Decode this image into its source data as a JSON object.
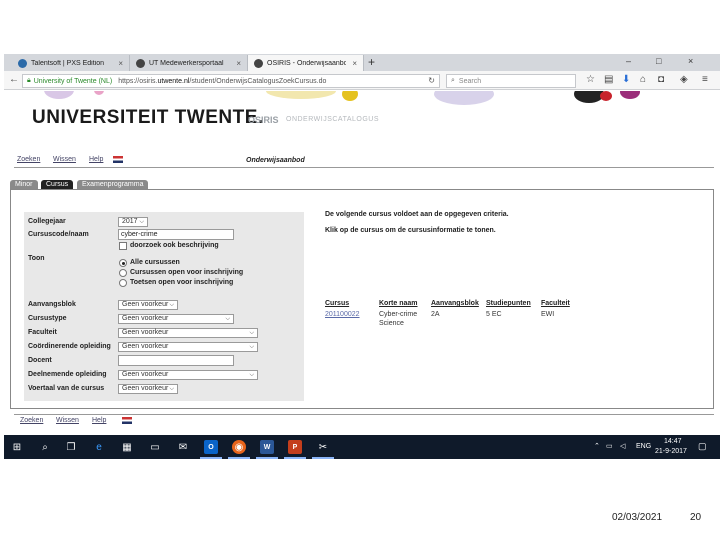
{
  "browser": {
    "tabs": [
      {
        "label": "Talentsoft | PXS Edition",
        "close": "×"
      },
      {
        "label": "UT Medewerkersportaal",
        "close": "×"
      },
      {
        "label": "OSIRIS - Onderwijsaanbod",
        "close": "×"
      }
    ],
    "new_tab": "+",
    "window_controls": [
      "–",
      "□",
      "×"
    ],
    "site_identity": "University of Twente (NL)",
    "url_prefix": "https://osiris.",
    "url_domain": "utwente.nl",
    "url_path": "/student/OnderwijsCatalogusZoekCursus.do",
    "search_placeholder": "Search"
  },
  "header": {
    "university": "UNIVERSITEIT TWENTE.",
    "app_name": "OSIRIS",
    "app_subtitle": "ONDERWIJSCATALOGUS"
  },
  "toplinks": {
    "zoeken": "Zoeken",
    "wissen": "Wissen",
    "help": "Help"
  },
  "section_title": "Onderwijsaanbod",
  "page_tabs": [
    "Minor",
    "Cursus",
    "Examenprogramma"
  ],
  "form": {
    "collegejaar_label": "Collegejaar",
    "collegejaar_value": "2017",
    "cursuscode_label": "Cursuscode/naam",
    "cursuscode_value": "cyber-crime",
    "doorzoek_label": "doorzoek ook beschrijving",
    "toon_label": "Toon",
    "toon_options": [
      "Alle cursussen",
      "Cursussen open voor inschrijving",
      "Toetsen open voor inschrijving"
    ],
    "aanvangsblok_label": "Aanvangsblok",
    "aanvangsblok_value": "Geen voorkeur",
    "cursustype_label": "Cursustype",
    "cursustype_value": "Geen voorkeur",
    "faculteit_label": "Faculteit",
    "faculteit_value": "Geen voorkeur",
    "coordinerende_label": "Coördinerende opleiding",
    "coordinerende_value": "Geen voorkeur",
    "docent_label": "Docent",
    "docent_value": "",
    "deelnemende_label": "Deelnemende opleiding",
    "deelnemende_value": "Geen voorkeur",
    "voertaal_label": "Voertaal van de cursus",
    "voertaal_value": "Geen voorkeur"
  },
  "results": {
    "line1": "De volgende cursus voldoet aan de opgegeven criteria.",
    "line2": "Klik op de cursus om de cursusinformatie te tonen.",
    "headers": [
      "Cursus",
      "Korte naam",
      "Aanvangsblok",
      "Studiepunten",
      "Faculteit"
    ],
    "row": {
      "cursus": "201100022",
      "korte_naam_1": "Cyber-crime",
      "korte_naam_2": "Science",
      "aanvangsblok": "2A",
      "studiepunten": "5 EC",
      "faculteit": "EWI"
    }
  },
  "taskbar": {
    "language": "ENG",
    "time": "14:47",
    "date": "21-9-2017"
  },
  "slide_footer": {
    "date": "02/03/2021",
    "page": "20"
  }
}
